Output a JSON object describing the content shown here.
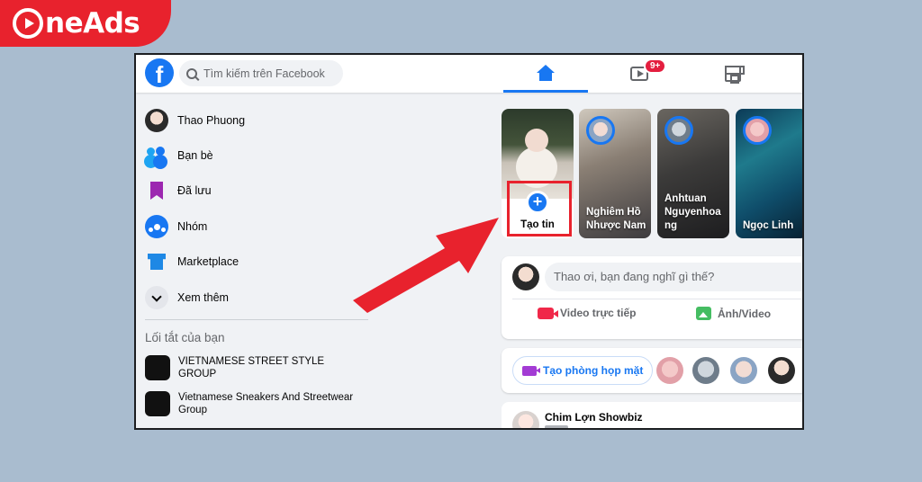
{
  "brand": {
    "name": "neAds"
  },
  "topbar": {
    "logo_letter": "f",
    "search_placeholder": "Tìm kiếm trên Facebook",
    "watch_badge": "9+"
  },
  "sidebar": {
    "items": [
      {
        "label": "Thao Phuong",
        "icon": "profile-avatar"
      },
      {
        "label": "Bạn bè",
        "icon": "friends-icon"
      },
      {
        "label": "Đã lưu",
        "icon": "saved-icon"
      },
      {
        "label": "Nhóm",
        "icon": "groups-icon"
      },
      {
        "label": "Marketplace",
        "icon": "marketplace-icon"
      },
      {
        "label": "Xem thêm",
        "icon": "chevron-down-icon"
      }
    ],
    "shortcuts_heading": "Lối tắt của bạn",
    "shortcuts": [
      {
        "label": "VIETNAMESE STREET STYLE GROUP"
      },
      {
        "label": "Vietnamese Sneakers And Streetwear Group"
      }
    ]
  },
  "stories": {
    "create_label": "Tạo tin",
    "create_icon": "plus",
    "items": [
      {
        "name": "Nghiêm Hồ Nhược Nam"
      },
      {
        "name": "Anhtuan Nguyenhoa ng"
      },
      {
        "name": "Ngọc Linh"
      }
    ]
  },
  "composer": {
    "placeholder": "Thao ơi, bạn đang nghĩ gì thế?",
    "live_label": "Video trực tiếp",
    "photo_label": "Ảnh/Video"
  },
  "rooms": {
    "button_label": "Tạo phòng họp mặt"
  },
  "post": {
    "author": "Chim Lợn Showbiz"
  },
  "colors": {
    "accent": "#1877f2",
    "highlight": "#e8222d",
    "brand_bg": "#e8222d"
  }
}
